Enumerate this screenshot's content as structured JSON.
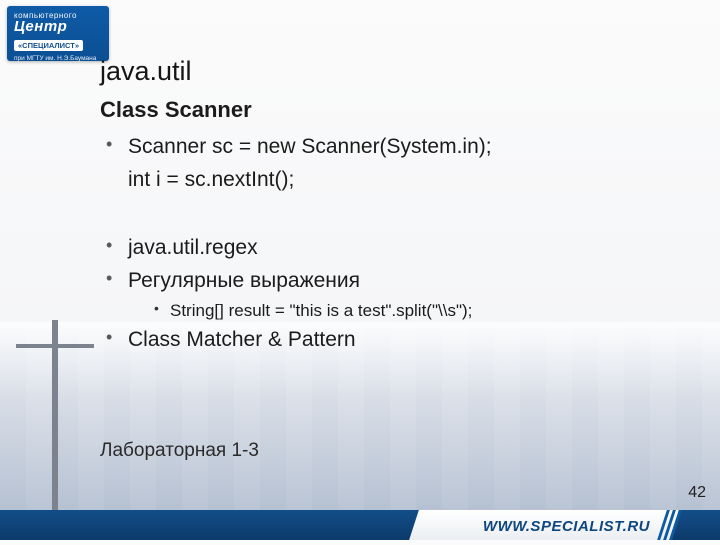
{
  "logo": {
    "line1": "компьютерного",
    "line2": "Центр",
    "line3": "«СПЕЦИАЛИСТ»",
    "line4": "при МГТУ им. Н.Э.Баумана"
  },
  "heading": "java.util",
  "subheading": "Class Scanner",
  "bullets": {
    "scanner_code1": "Scanner sc = new Scanner(System.in);",
    "scanner_code2": "int   i = sc.nextInt();",
    "regex_heading": "java.util.regex",
    "regex_desc": "Регулярные выражения",
    "regex_code": "String[] result = \"this is a test\".split(\"\\\\s\");",
    "matcher": "Class Matcher & Pattern"
  },
  "lab_label": "Лабораторная 1-3",
  "footer_url": "WWW.SPECIALIST.RU",
  "page_number": "42"
}
